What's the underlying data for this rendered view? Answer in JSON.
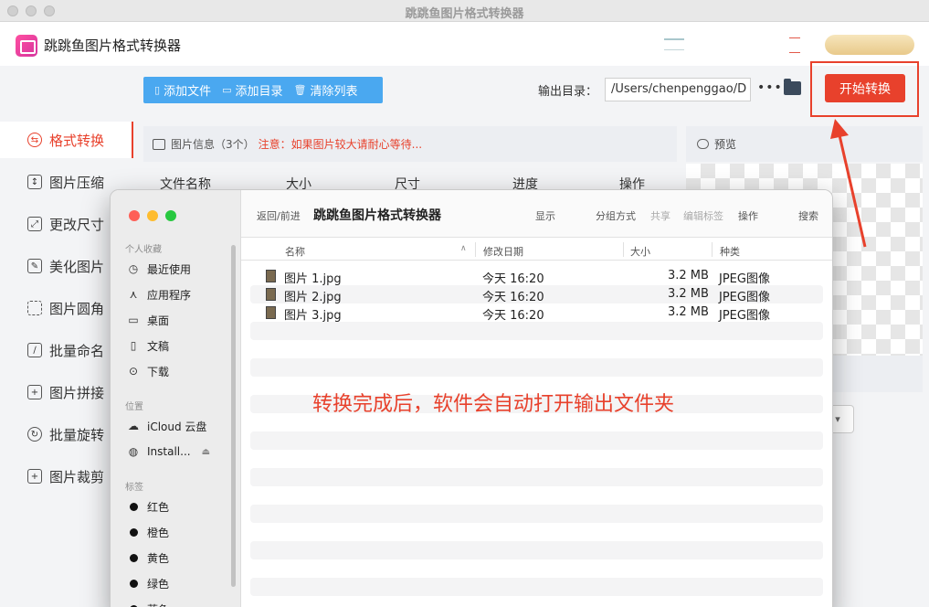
{
  "window": {
    "title": "跳跳鱼图片格式转换器"
  },
  "app": {
    "name": "跳跳鱼图片格式转换器"
  },
  "sidebar": {
    "items": [
      {
        "label": "格式转换",
        "icon": "convert-icon",
        "active": true
      },
      {
        "label": "图片压缩",
        "icon": "compress-icon"
      },
      {
        "label": "更改尺寸",
        "icon": "resize-icon"
      },
      {
        "label": "美化图片",
        "icon": "beautify-icon"
      },
      {
        "label": "图片圆角",
        "icon": "rounded-corner-icon"
      },
      {
        "label": "批量命名",
        "icon": "rename-icon"
      },
      {
        "label": "图片拼接",
        "icon": "stitch-icon"
      },
      {
        "label": "批量旋转",
        "icon": "rotate-icon"
      },
      {
        "label": "图片裁剪",
        "icon": "crop-icon"
      }
    ]
  },
  "toolbar": {
    "add_file": "添加文件",
    "add_folder": "添加目录",
    "clear_list": "清除列表",
    "output_label": "输出目录：",
    "output_path": "/Users/chenpenggao/D",
    "more": "•••",
    "start_label": "开始转换"
  },
  "info": {
    "title": "图片信息（3个）",
    "warning": "注意：如果图片较大请耐心等待..."
  },
  "table": {
    "columns": [
      "文件名称",
      "大小",
      "尺寸",
      "进度",
      "操作"
    ]
  },
  "preview": {
    "title": "预览"
  },
  "finder": {
    "nav": "返回/前进",
    "title": "跳跳鱼图片格式转换器",
    "toolbar": {
      "show": "显示",
      "group": "分组方式",
      "share": "共享",
      "edit_tags": "编辑标签",
      "action": "操作",
      "search": "搜索"
    },
    "sections": {
      "favorites": "个人收藏",
      "locations": "位置",
      "tags": "标签"
    },
    "favorites": [
      "最近使用",
      "应用程序",
      "桌面",
      "文稿",
      "下载"
    ],
    "locations": [
      "iCloud 云盘",
      "Install..."
    ],
    "tags": [
      "红色",
      "橙色",
      "黄色",
      "绿色",
      "蓝色"
    ],
    "columns": {
      "name": "名称",
      "date": "修改日期",
      "size": "大小",
      "kind": "种类"
    },
    "files": [
      {
        "name": "图片 1.jpg",
        "date": "今天 16:20",
        "size": "3.2 MB",
        "kind": "JPEG图像"
      },
      {
        "name": "图片 2.jpg",
        "date": "今天 16:20",
        "size": "3.2 MB",
        "kind": "JPEG图像"
      },
      {
        "name": "图片 3.jpg",
        "date": "今天 16:20",
        "size": "3.2 MB",
        "kind": "JPEG图像"
      }
    ]
  },
  "annotation": {
    "text": "转换完成后，软件会自动打开输出文件夹"
  }
}
